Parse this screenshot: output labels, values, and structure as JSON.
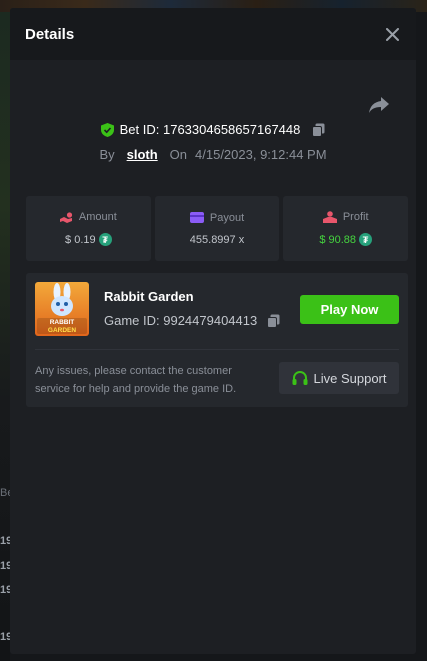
{
  "modal": {
    "title": "Details",
    "close_icon": "close-icon",
    "share_icon": "share-icon"
  },
  "bet": {
    "id_label": "Bet ID: 1763304658657167448",
    "by_label": "By",
    "user": "sloth",
    "on_label": "On",
    "datetime": "4/15/2023, 9:12:44 PM"
  },
  "stats": {
    "amount": {
      "label": "Amount",
      "value": "$ 0.19",
      "icon": "hand-coins-icon",
      "color": "#e8566b"
    },
    "payout": {
      "label": "Payout",
      "value": "455.8997 x",
      "icon": "card-icon",
      "color": "#8b5cf6"
    },
    "profit": {
      "label": "Profit",
      "value": "$ 90.88",
      "icon": "profit-icon",
      "color": "#e8566b",
      "value_color": "#45d43f"
    }
  },
  "game": {
    "name": "Rabbit Garden",
    "thumb_text": "RABBIT GARDEN",
    "id_label": "Game ID: 9924479404413",
    "play_label": "Play Now",
    "issue_text": "Any issues, please contact the customer service for help and provide the game ID.",
    "support_label": "Live Support"
  },
  "background": {
    "marks": [
      "Be",
      "19",
      "19",
      "19",
      "19"
    ]
  },
  "colors": {
    "accent_green": "#3bc117",
    "modal_bg": "#1d1f23",
    "card_bg": "#25282d"
  }
}
